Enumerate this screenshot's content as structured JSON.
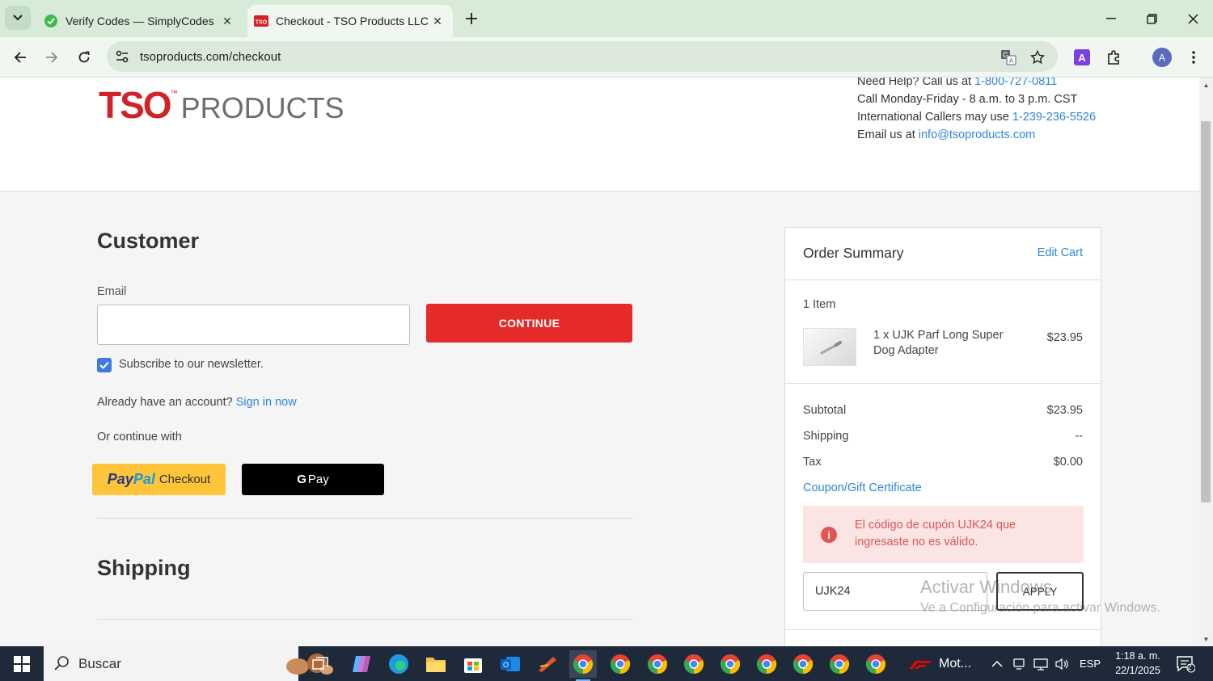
{
  "browser": {
    "tabs": [
      {
        "title": "Verify Codes — SimplyCodes",
        "close": "✕"
      },
      {
        "title": "Checkout - TSO Products LLC.",
        "close": "✕"
      }
    ],
    "url": "tsoproducts.com/checkout"
  },
  "header": {
    "logo_tso": "TSO",
    "logo_tm": "™",
    "logo_products": "PRODUCTS",
    "help_line1_prefix": "Need Help? Call us at ",
    "help_line1_phone": "1-800-727-0811",
    "help_line2": "Call Monday-Friday - 8 a.m. to 3 p.m. CST",
    "help_line3_prefix": "International Callers may use ",
    "help_line3_phone": "1-239-236-5526",
    "help_line4_prefix": "Email us at ",
    "help_line4_email": "info@tsoproducts.com"
  },
  "customer": {
    "title": "Customer",
    "email_label": "Email",
    "email_value": "",
    "continue_label": "CONTINUE",
    "newsletter_label": "Subscribe to our newsletter.",
    "newsletter_checked": true,
    "account_prefix": "Already have an account?",
    "sign_in_link": "Sign in now",
    "continue_with": "Or continue with",
    "paypal_1": "Pay",
    "paypal_2": "Pal",
    "paypal_3": "Checkout",
    "gpay_g": "G",
    "gpay_label": "Pay"
  },
  "shipping": {
    "title": "Shipping"
  },
  "summary": {
    "title": "Order Summary",
    "edit_cart": "Edit Cart",
    "item_count": "1 Item",
    "item_name": "1 x UJK Parf Long Super Dog Adapter",
    "item_price": "$23.95",
    "subtotal_label": "Subtotal",
    "subtotal_value": "$23.95",
    "shipping_label": "Shipping",
    "shipping_value": "--",
    "tax_label": "Tax",
    "tax_value": "$0.00",
    "coupon_link": "Coupon/Gift Certificate",
    "alert_message": "El código de cupón UJK24 que ingresaste no es válido.",
    "coupon_value": "UJK24",
    "apply_label": "APPLY"
  },
  "watermark": {
    "line1": "Activar Windows",
    "line2": "Ve a Configuración para activar Windows."
  },
  "taskbar": {
    "search_text": "Buscar",
    "app_label": "Mot...",
    "language": "ESP",
    "time": "1:18 a. m.",
    "date": "22/1/2025",
    "notifications": "2"
  },
  "colors": {
    "brand_red": "#d42128",
    "continue_red": "#e52a2a",
    "link_blue": "#2f86dd",
    "error_text": "#e05555",
    "error_bg": "#fbe4e4"
  }
}
